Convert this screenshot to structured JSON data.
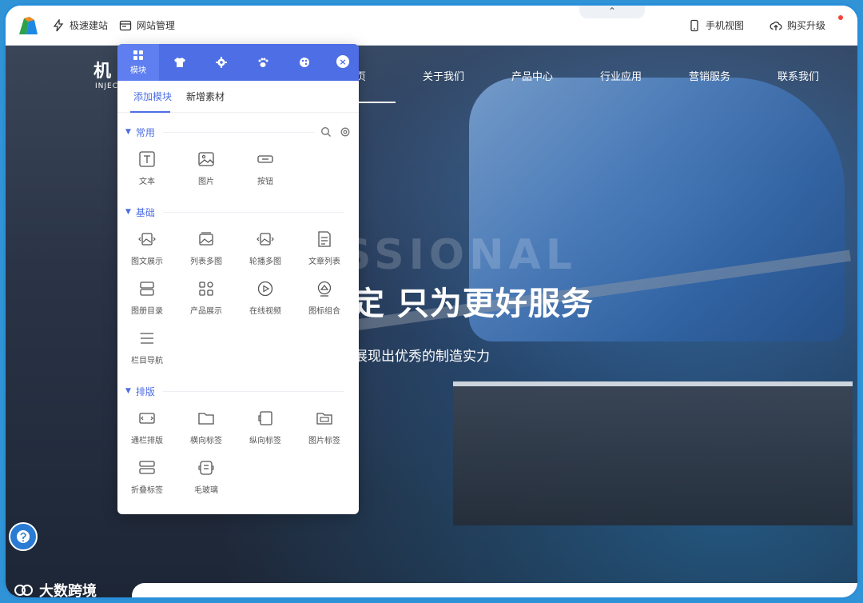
{
  "topbar": {
    "quick_build": "极速建站",
    "site_manage": "网站管理",
    "mobile_view": "手机视图",
    "upgrade": "购买升级",
    "collapse_glyph": "⌃"
  },
  "site": {
    "brand": "机",
    "brand_sub": "INJEC",
    "nav": [
      "页",
      "关于我们",
      "产品中心",
      "行业应用",
      "营销服务",
      "联系我们"
    ],
    "watermark": "SSIONAL",
    "hero_title": "定 只为更好服务",
    "hero_sub": "展现出优秀的制造实力"
  },
  "panel": {
    "tabs": [
      {
        "label": "模块",
        "icon": "grid-icon"
      },
      {
        "label": "",
        "icon": "shirt-icon"
      },
      {
        "label": "",
        "icon": "gear-icon"
      },
      {
        "label": "",
        "icon": "paw-icon"
      },
      {
        "label": "",
        "icon": "palette-icon"
      }
    ],
    "close_glyph": "×",
    "subtabs": [
      "添加模块",
      "新增素材"
    ],
    "sections": [
      {
        "title": "常用",
        "items": [
          {
            "label": "文本",
            "icon": "text-icon"
          },
          {
            "label": "图片",
            "icon": "image-icon"
          },
          {
            "label": "按钮",
            "icon": "button-icon"
          }
        ]
      },
      {
        "title": "基础",
        "items": [
          {
            "label": "图文展示",
            "icon": "image-text-icon"
          },
          {
            "label": "列表多图",
            "icon": "list-images-icon"
          },
          {
            "label": "轮播多图",
            "icon": "carousel-icon"
          },
          {
            "label": "文章列表",
            "icon": "article-list-icon"
          },
          {
            "label": "图册目录",
            "icon": "catalog-icon"
          },
          {
            "label": "产品展示",
            "icon": "product-icon"
          },
          {
            "label": "在线视频",
            "icon": "video-icon"
          },
          {
            "label": "图标组合",
            "icon": "icon-combo-icon"
          },
          {
            "label": "栏目导航",
            "icon": "column-nav-icon"
          }
        ]
      },
      {
        "title": "排版",
        "items": [
          {
            "label": "通栏排版",
            "icon": "fullwidth-icon"
          },
          {
            "label": "横向标签",
            "icon": "horizontal-tab-icon"
          },
          {
            "label": "纵向标签",
            "icon": "vertical-tab-icon"
          },
          {
            "label": "图片标签",
            "icon": "image-tab-icon"
          },
          {
            "label": "折叠标签",
            "icon": "fold-tab-icon"
          },
          {
            "label": "毛玻璃",
            "icon": "frosted-icon"
          }
        ]
      }
    ]
  },
  "bottom_watermark": "大数跨境",
  "colors": {
    "accent": "#4e6ee5",
    "frame": "#2a8fd9"
  }
}
